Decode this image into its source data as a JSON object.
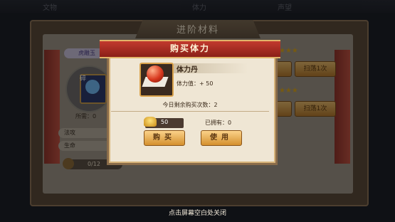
{
  "background": {
    "top_bar": [
      "文物",
      "体力",
      "声望"
    ],
    "panel_title": "进阶材料",
    "hero_name": "虎雕玉",
    "hero_tag": "碎",
    "need_label": "所需：0",
    "stat_rows": [
      "法攻",
      "生命"
    ],
    "progress": "0/12",
    "side_buttons": [
      "扫荡1次",
      "扫荡1次"
    ]
  },
  "dialog": {
    "title": "购买体力",
    "item_name": "体力丹",
    "item_effect": "体力值：+ 50",
    "remaining": "今日剩余购买次数：2",
    "cost": "50",
    "owned": "已拥有：0",
    "buy_label": "购买",
    "use_label": "使用"
  },
  "hint": "点击屏幕空白处关闭",
  "colors": {
    "ribbon": "#c23a2e",
    "button": "#d4902e",
    "gold": "#d9a24b"
  }
}
